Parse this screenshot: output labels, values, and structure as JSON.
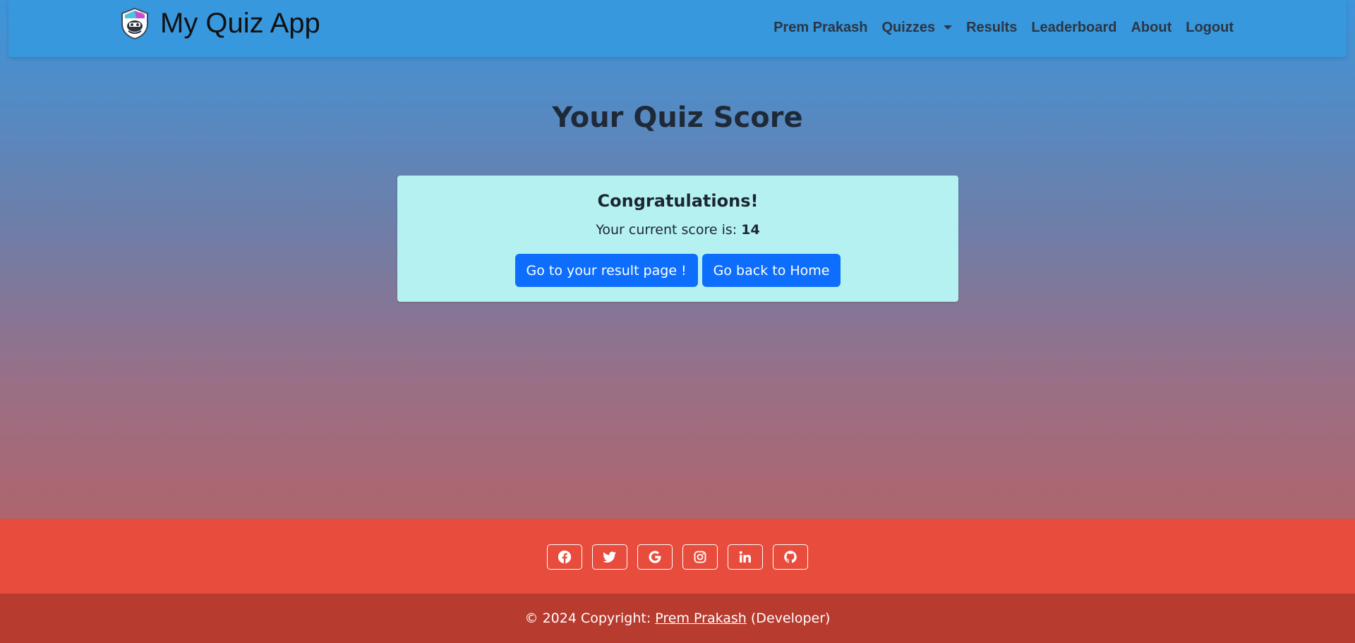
{
  "navbar": {
    "brand": "My Quiz App",
    "brand_logo_icon": "shield-mascot-logo",
    "links": {
      "user": "Prem Prakash",
      "quizzes": "Quizzes",
      "results": "Results",
      "leaderboard": "Leaderboard",
      "about": "About",
      "logout": "Logout"
    }
  },
  "main": {
    "title": "Your Quiz Score",
    "card": {
      "heading": "Congratulations!",
      "score_prefix": "Your current score is: ",
      "score_value": "14",
      "result_button": "Go to your result page !",
      "home_button": "Go back to Home"
    }
  },
  "footer": {
    "social_icons": [
      "facebook-icon",
      "twitter-icon",
      "google-icon",
      "instagram-icon",
      "linkedin-icon",
      "github-icon"
    ],
    "copyright_prefix": "© 2024 Copyright: ",
    "developer_name": "Prem Prakash",
    "developer_suffix": " (Developer)"
  },
  "colors": {
    "navbar_bg": "#3898dd",
    "card_bg": "#b6f1f2",
    "button_primary": "#0d6efd",
    "footer_social_bg": "#e74c3c",
    "footer_copy_bg": "#b83b2f"
  }
}
